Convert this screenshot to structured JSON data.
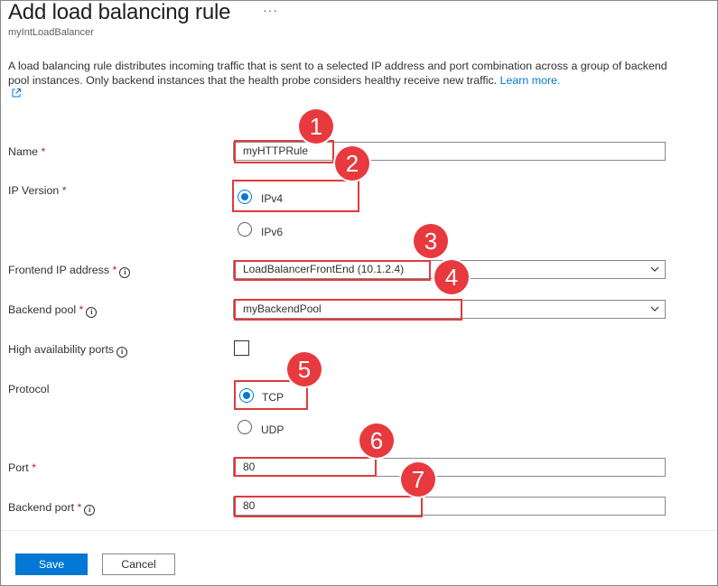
{
  "header": {
    "title": "Add load balancing rule",
    "more_label": "···",
    "subtitle": "myIntLoadBalancer"
  },
  "description": {
    "text": "A load balancing rule distributes incoming traffic that is sent to a selected IP address and port combination across a group of backend pool instances. Only backend instances that the health probe considers healthy receive new traffic.",
    "link": "Learn more."
  },
  "form": {
    "name": {
      "label": "Name",
      "required": "*",
      "value": "myHTTPRule"
    },
    "ip_version": {
      "label": "IP Version",
      "required": "*",
      "options": [
        "IPv4",
        "IPv6"
      ],
      "selected": "IPv4"
    },
    "frontend_ip": {
      "label": "Frontend IP address",
      "required": "*",
      "info": "i",
      "value": "LoadBalancerFrontEnd (10.1.2.4)"
    },
    "backend_pool": {
      "label": "Backend pool",
      "required": "*",
      "info": "i",
      "value": "myBackendPool"
    },
    "ha_ports": {
      "label": "High availability ports",
      "info": "i",
      "checked": false
    },
    "protocol": {
      "label": "Protocol",
      "options": [
        "TCP",
        "UDP"
      ],
      "selected": "TCP"
    },
    "port": {
      "label": "Port",
      "required": "*",
      "value": "80"
    },
    "backend_port": {
      "label": "Backend port",
      "required": "*",
      "info": "i",
      "value": "80"
    }
  },
  "badges": [
    "1",
    "2",
    "3",
    "4",
    "5",
    "6",
    "7"
  ],
  "footer": {
    "save_label": "Save",
    "cancel_label": "Cancel"
  },
  "colors": {
    "accent": "#0078d4",
    "highlight": "#e03a3e",
    "required": "#a4262c"
  }
}
